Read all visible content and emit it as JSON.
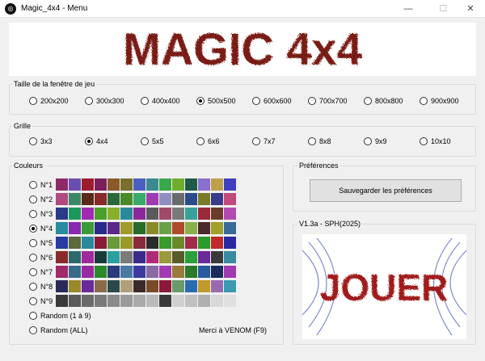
{
  "window": {
    "title": "Magic_4x4 - Menu",
    "min": "—",
    "max": "☐",
    "close": "✕"
  },
  "banner": {
    "text": "MAGIC 4x4"
  },
  "size_group": {
    "title": "Taille de la fenêtre de jeu",
    "options": [
      "200x200",
      "300x300",
      "400x400",
      "500x500",
      "600x600",
      "700x700",
      "800x800",
      "900x900"
    ],
    "selected": 3
  },
  "grid_group": {
    "title": "Grille",
    "options": [
      "3x3",
      "4x4",
      "5x5",
      "6x6",
      "7x7",
      "8x8",
      "9x9",
      "10x10"
    ],
    "selected": 1
  },
  "colors_group": {
    "title": "Couleurs",
    "options": [
      "N°1",
      "N°2",
      "N°3",
      "N°4",
      "N°5",
      "N°6",
      "N°7",
      "N°8",
      "N°9",
      "Random (1 à 9)",
      "Random (ALL)"
    ],
    "selected": 3,
    "palettes": [
      [
        "#8e2a6a",
        "#6a4fb3",
        "#9b1b2f",
        "#7a1f5c",
        "#8a5a2a",
        "#7a6e2a",
        "#4b5fc0",
        "#3a8a8f",
        "#3aa84a",
        "#6fae2a",
        "#1f5a4a",
        "#8a6fd0",
        "#bfa04a",
        "#3f3fbf"
      ],
      [
        "#b04a80",
        "#3a8a6a",
        "#5a2a1a",
        "#8a2a2a",
        "#2a6a3a",
        "#4a8a2a",
        "#3aaa6a",
        "#a03ab0",
        "#8f8fbf",
        "#6a6a6a",
        "#2a4a8a",
        "#7a7a2a",
        "#3a3a8a",
        "#c04a7a"
      ],
      [
        "#2a3a8a",
        "#1a9a5a",
        "#a02ab0",
        "#4aa02a",
        "#8ab02a",
        "#2a8a9a",
        "#8a2a9a",
        "#5a5a5a",
        "#a04a6a",
        "#7a7a7a",
        "#3aa09a",
        "#9a2a3a",
        "#6a3a2a",
        "#b04ab0"
      ],
      [
        "#2a8aa0",
        "#8a2ab0",
        "#3a9a3a",
        "#2a2a8a",
        "#5a2a8a",
        "#a09a2a",
        "#2a6a2a",
        "#8a8a2a",
        "#6aa04a",
        "#b04a2a",
        "#8ab04a",
        "#4a2a2a",
        "#a0a02a",
        "#3a6a9a"
      ],
      [
        "#2a3aa0",
        "#5a6a3a",
        "#2a8a9a",
        "#8a1a3a",
        "#6a9a3a",
        "#9a9a2a",
        "#8a2a3a",
        "#2a2a2a",
        "#3a9a2a",
        "#6a8a2a",
        "#a02a4a",
        "#2a9a2a",
        "#c02a2a",
        "#2a2aa0"
      ],
      [
        "#8a2a2a",
        "#2a6a6a",
        "#a02a9a",
        "#1a3a3a",
        "#2aa0a0",
        "#7a7a7a",
        "#3a2a8a",
        "#b02a7a",
        "#9a9a3a",
        "#5a5a2a",
        "#2aa03a",
        "#6a2a9a",
        "#3a3a3a",
        "#3a8aa0"
      ],
      [
        "#a02a6a",
        "#3a6a8a",
        "#9a2aa0",
        "#2a8a2a",
        "#2a3a7a",
        "#4a7aa0",
        "#3a3aa0",
        "#8a6aa0",
        "#a03ab0",
        "#9a7a3a",
        "#2a7a2a",
        "#2a5aa0",
        "#1a2a5a",
        "#a03ab0"
      ],
      [
        "#2a2a5a",
        "#9a8a2a",
        "#6a2a9a",
        "#8a6a4a",
        "#2a4a4a",
        "#b0a07a",
        "#3a2a2a",
        "#7a4a2a",
        "#8a1a3a",
        "#6a9a6a",
        "#2a6ab0",
        "#c09a2a",
        "#9a6ab0",
        "#3a9ab0"
      ],
      [
        "#3a3a3a",
        "#5a5a5a",
        "#6a6a6a",
        "#7a7a7a",
        "#8a8a8a",
        "#9a9a9a",
        "#aaaaaa",
        "#bababa",
        "#3a3a3a",
        "#d0d0d0",
        "#c0c0c0",
        "#b0b0b0",
        "#d8d8d8",
        "#e0e0e0"
      ]
    ]
  },
  "prefs_group": {
    "title": "Préférences",
    "save_label": "Sauvegarder les préférences"
  },
  "version_group": {
    "title": "V1.3a - SPH(2025)",
    "play_label": "JOUER"
  },
  "credit": "Merci à VENOM (F9)"
}
